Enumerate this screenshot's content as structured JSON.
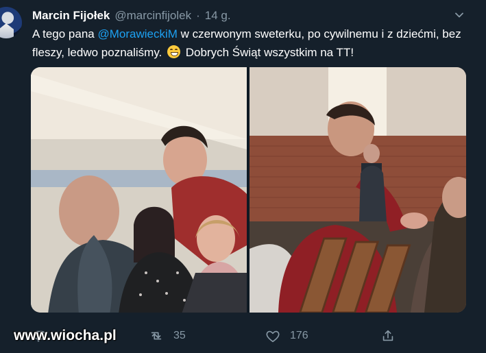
{
  "tweet": {
    "author_name": "Marcin Fijołek",
    "author_handle": "@marcinfijolek",
    "separator": "·",
    "time": "14 g.",
    "text_part1": "A tego pana ",
    "mention": "@MorawieckiM",
    "text_part2": " w czerwonym sweterku, po cywilnemu i z dziećmi, bez fleszy, ledwo poznaliśmy.",
    "text_part3": "Dobrych Świąt wszystkim na TT!",
    "emoji": "grinning-face-with-smiling-eyes",
    "images": [
      {
        "description_icon": "photo-left"
      },
      {
        "description_icon": "photo-right"
      }
    ]
  },
  "actions": {
    "reply_count": "",
    "retweet_count": "35",
    "like_count": "176"
  },
  "watermark": "www.wiocha.pl",
  "colors": {
    "background": "#15202b",
    "text": "#ffffff",
    "secondary_text": "#8899a6",
    "link": "#1da1f2"
  },
  "icons": {
    "reply": "reply-icon",
    "retweet": "retweet-icon",
    "like": "heart-icon",
    "share": "share-icon",
    "menu": "chevron-down-icon"
  }
}
